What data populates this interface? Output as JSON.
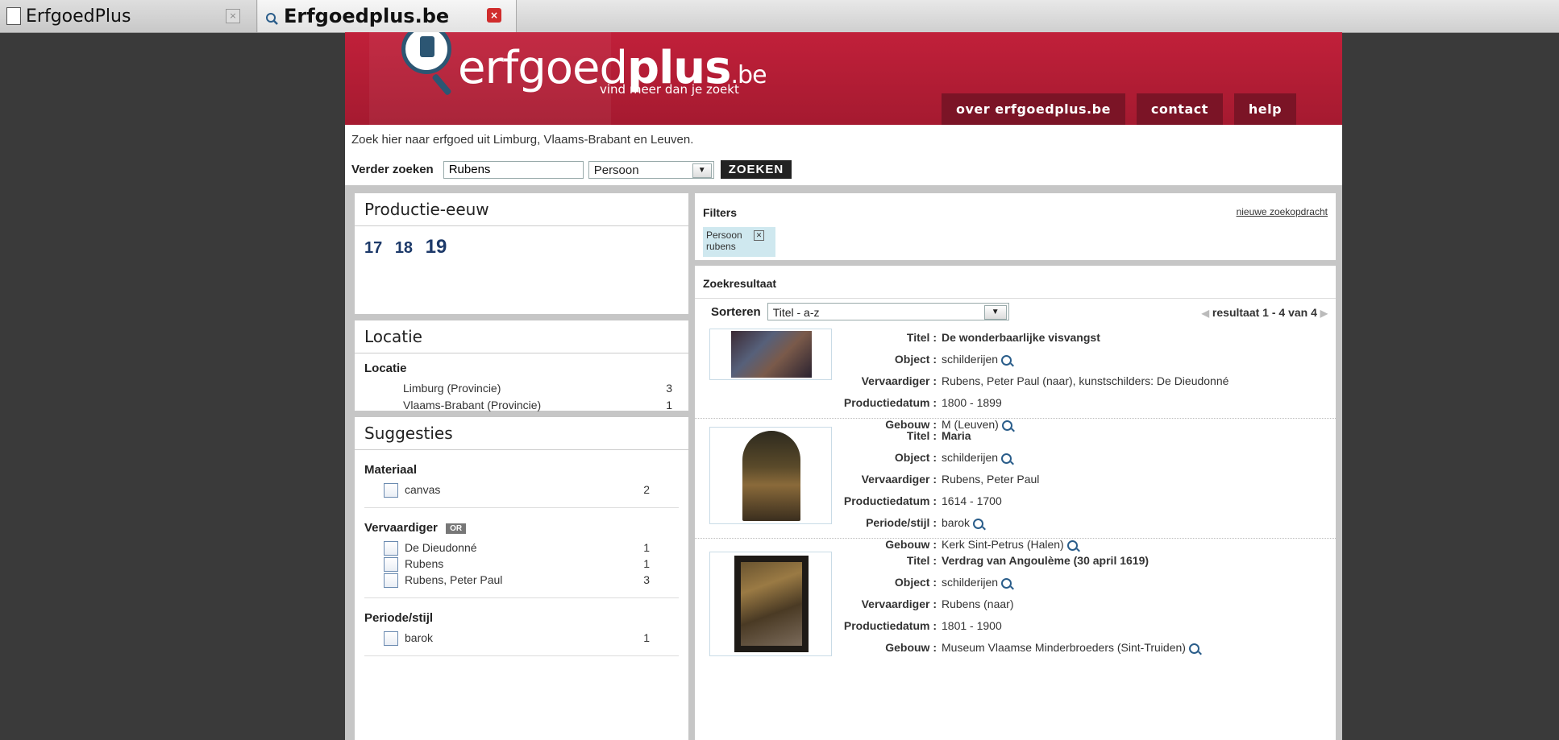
{
  "tabs": [
    {
      "label": "ErfgoedPlus",
      "close": "×"
    },
    {
      "label": "Erfgoedplus.be",
      "close": "×"
    }
  ],
  "banner": {
    "logo_main": "erfgoed",
    "logo_bold": "plus",
    "logo_tld": ".be",
    "tagline": "vind meer dan je zoekt",
    "nav": [
      "over erfgoedplus.be",
      "contact",
      "help"
    ]
  },
  "search": {
    "intro": "Zoek hier naar erfgoed uit Limburg, Vlaams-Brabant en Leuven.",
    "label": "Verder zoeken",
    "value": "Rubens",
    "type_selected": "Persoon",
    "button": "ZOEKEN"
  },
  "century_panel": {
    "title": "Productie-eeuw",
    "centuries": [
      "17",
      "18",
      "19"
    ]
  },
  "location_panel": {
    "title": "Locatie",
    "subtitle": "Locatie",
    "items": [
      {
        "label": "Limburg (Provincie)",
        "count": "3"
      },
      {
        "label": "Vlaams-Brabant (Provincie)",
        "count": "1"
      }
    ]
  },
  "suggestions": {
    "title": "Suggesties",
    "materiaal": {
      "title": "Materiaal",
      "items": [
        {
          "label": "canvas",
          "count": "2"
        }
      ]
    },
    "vervaardiger": {
      "title": "Vervaardiger",
      "badge": "OR",
      "items": [
        {
          "label": "De Dieudonné",
          "count": "1"
        },
        {
          "label": "Rubens",
          "count": "1"
        },
        {
          "label": "Rubens, Peter Paul",
          "count": "3"
        }
      ]
    },
    "periode": {
      "title": "Periode/stijl",
      "items": [
        {
          "label": "barok",
          "count": "1"
        }
      ]
    }
  },
  "filters": {
    "title": "Filters",
    "new_query": "nieuwe zoekopdracht",
    "chip_type": "Persoon",
    "chip_value": "rubens"
  },
  "results": {
    "title": "Zoekresultaat",
    "sort_label": "Sorteren",
    "sort_selected": "Titel - a-z",
    "paging": "resultaat 1 - 4 van 4",
    "labels": {
      "titel": "Titel :",
      "object": "Object :",
      "vervaardiger": "Vervaardiger :",
      "productiedatum": "Productiedatum :",
      "periode": "Periode/stijl :",
      "gebouw": "Gebouw :"
    },
    "items": [
      {
        "titel": "De wonderbaarlijke visvangst",
        "object": "schilderijen",
        "vervaardiger": "Rubens, Peter Paul (naar), kunstschilders: De Dieudonné",
        "productiedatum": "1800 - 1899",
        "gebouw": "M (Leuven)"
      },
      {
        "titel": "Maria",
        "object": "schilderijen",
        "vervaardiger": "Rubens, Peter Paul",
        "productiedatum": "1614 - 1700",
        "periode": "barok",
        "gebouw": "Kerk Sint-Petrus (Halen)"
      },
      {
        "titel": "Verdrag van Angoulème (30 april 1619)",
        "object": "schilderijen",
        "vervaardiger": "Rubens (naar)",
        "productiedatum": "1801 - 1900",
        "gebouw": "Museum Vlaamse Minderbroeders (Sint-Truiden)"
      }
    ]
  }
}
